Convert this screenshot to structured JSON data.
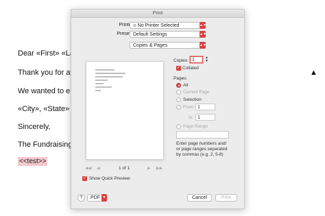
{
  "document": {
    "lines": [
      "Dear «First» «Last",
      "Thank you for atte",
      "We wanted to ens",
      "«City», «State»",
      "Sincerely,",
      "The Fundraising T"
    ],
    "merge_field": "<<test>>"
  },
  "dialog": {
    "title": "Print",
    "printer_label": "Printer:",
    "printer_value": "No Printer Selected",
    "presets_label": "Presets:",
    "presets_value": "Default Settings",
    "section_value": "Copies & Pages",
    "copies_label": "Copies:",
    "copies_value": "1",
    "collated_label": "Collated",
    "pages_label": "Pages:",
    "pages_options": [
      "All",
      "Current Page",
      "Selection"
    ],
    "from_label": "From:",
    "from_value": "1",
    "to_label": "to:",
    "to_value": "1",
    "page_range_label": "Page Range",
    "page_range_help": [
      "Enter page numbers and/",
      "or page ranges separated",
      "by commas (e.g. 2, 5-8)"
    ],
    "page_indicator": "1 of 1",
    "show_preview_label": "Show Quick Preview",
    "help_label": "?",
    "pdf_label": "PDF",
    "cancel_label": "Cancel",
    "print_label": "Print"
  },
  "colors": {
    "accent": "#d9413f",
    "highlight": "#f3c9cf"
  }
}
